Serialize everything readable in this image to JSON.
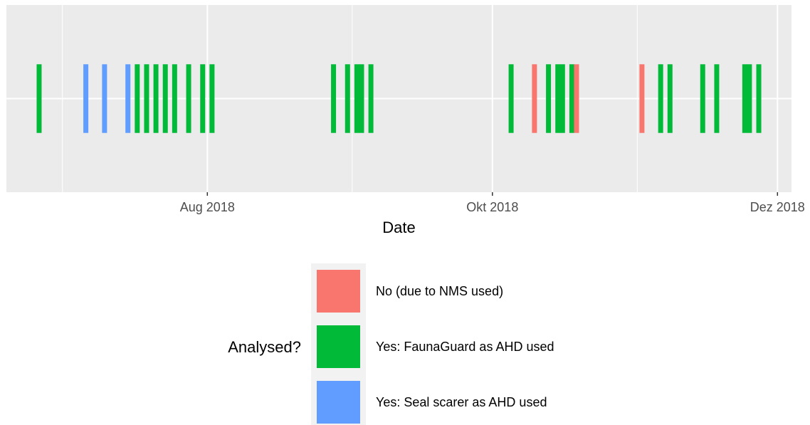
{
  "chart_data": {
    "type": "event-strip",
    "xlabel": "Date",
    "x_tick_labels": [
      "Aug 2018",
      "Okt 2018",
      "Dez 2018"
    ],
    "x_ticks": [
      "2018-08-01",
      "2018-10-01",
      "2018-12-01"
    ],
    "x_minor_ticks": [
      "2018-07-01",
      "2018-09-01",
      "2018-11-01"
    ],
    "xlim": [
      "2018-06-19",
      "2018-12-04"
    ],
    "y_range": [
      0.4,
      1.6
    ],
    "grid": true,
    "legend": {
      "title": "Analysed?",
      "position": "bottom",
      "entries": [
        {
          "key": "no",
          "label": "No (due to NMS used)",
          "color": "#F8766D"
        },
        {
          "key": "fauna",
          "label": "Yes: FaunaGuard as AHD used",
          "color": "#00BA38"
        },
        {
          "key": "seal",
          "label": "Yes: Seal scarer as AHD used",
          "color": "#619CFF"
        }
      ]
    },
    "events": [
      {
        "date": "2018-06-26",
        "category": "fauna"
      },
      {
        "date": "2018-07-06",
        "category": "seal"
      },
      {
        "date": "2018-07-10",
        "category": "seal"
      },
      {
        "date": "2018-07-15",
        "category": "seal"
      },
      {
        "date": "2018-07-17",
        "category": "fauna"
      },
      {
        "date": "2018-07-19",
        "category": "fauna"
      },
      {
        "date": "2018-07-21",
        "category": "fauna"
      },
      {
        "date": "2018-07-23",
        "category": "fauna"
      },
      {
        "date": "2018-07-25",
        "category": "fauna"
      },
      {
        "date": "2018-07-28",
        "category": "fauna"
      },
      {
        "date": "2018-07-31",
        "category": "fauna"
      },
      {
        "date": "2018-08-02",
        "category": "fauna"
      },
      {
        "date": "2018-08-28",
        "category": "fauna"
      },
      {
        "date": "2018-08-31",
        "category": "fauna"
      },
      {
        "date": "2018-09-02",
        "category": "fauna"
      },
      {
        "date": "2018-09-03",
        "category": "fauna"
      },
      {
        "date": "2018-09-05",
        "category": "fauna"
      },
      {
        "date": "2018-10-05",
        "category": "fauna"
      },
      {
        "date": "2018-10-10",
        "category": "no"
      },
      {
        "date": "2018-10-13",
        "category": "fauna"
      },
      {
        "date": "2018-10-15",
        "category": "fauna"
      },
      {
        "date": "2018-10-16",
        "category": "fauna"
      },
      {
        "date": "2018-10-18",
        "category": "fauna"
      },
      {
        "date": "2018-10-19",
        "category": "no"
      },
      {
        "date": "2018-11-02",
        "category": "no"
      },
      {
        "date": "2018-11-06",
        "category": "fauna"
      },
      {
        "date": "2018-11-08",
        "category": "fauna"
      },
      {
        "date": "2018-11-15",
        "category": "fauna"
      },
      {
        "date": "2018-11-18",
        "category": "fauna"
      },
      {
        "date": "2018-11-24",
        "category": "fauna"
      },
      {
        "date": "2018-11-25",
        "category": "fauna"
      },
      {
        "date": "2018-11-27",
        "category": "fauna"
      }
    ]
  }
}
